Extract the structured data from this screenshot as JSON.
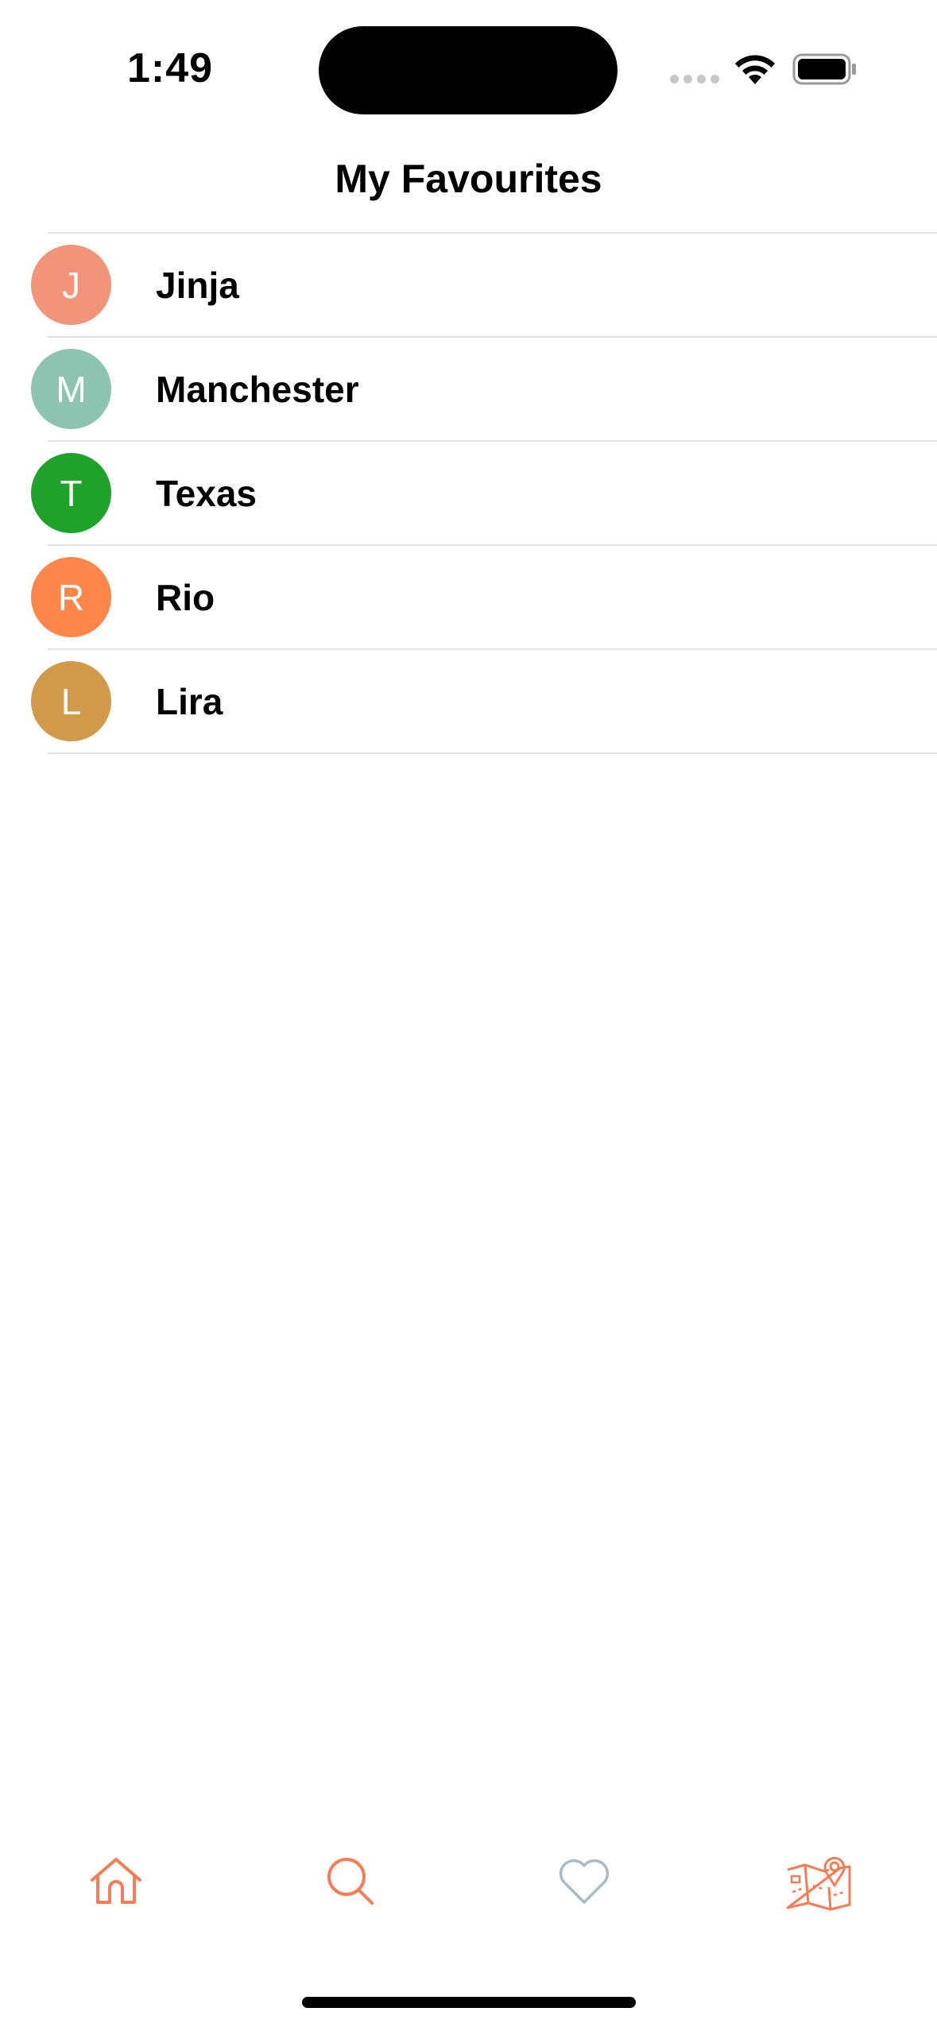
{
  "status_bar": {
    "time": "1:49"
  },
  "header": {
    "title": "My Favourites"
  },
  "favourites": [
    {
      "initial": "J",
      "name": "Jinja",
      "color": "#F29479"
    },
    {
      "initial": "M",
      "name": "Manchester",
      "color": "#8CC3B1"
    },
    {
      "initial": "T",
      "name": "Texas",
      "color": "#1EA229"
    },
    {
      "initial": "R",
      "name": "Rio",
      "color": "#FF864A"
    },
    {
      "initial": "L",
      "name": "Lira",
      "color": "#D09A4A"
    }
  ],
  "tab_bar": {
    "tabs": [
      {
        "icon": "home-icon",
        "color": "#F57C55"
      },
      {
        "icon": "search-icon",
        "color": "#F57C55"
      },
      {
        "icon": "heart-icon",
        "color": "#A9BCC4"
      },
      {
        "icon": "map-pin-icon",
        "color": "#F57C55"
      }
    ]
  }
}
